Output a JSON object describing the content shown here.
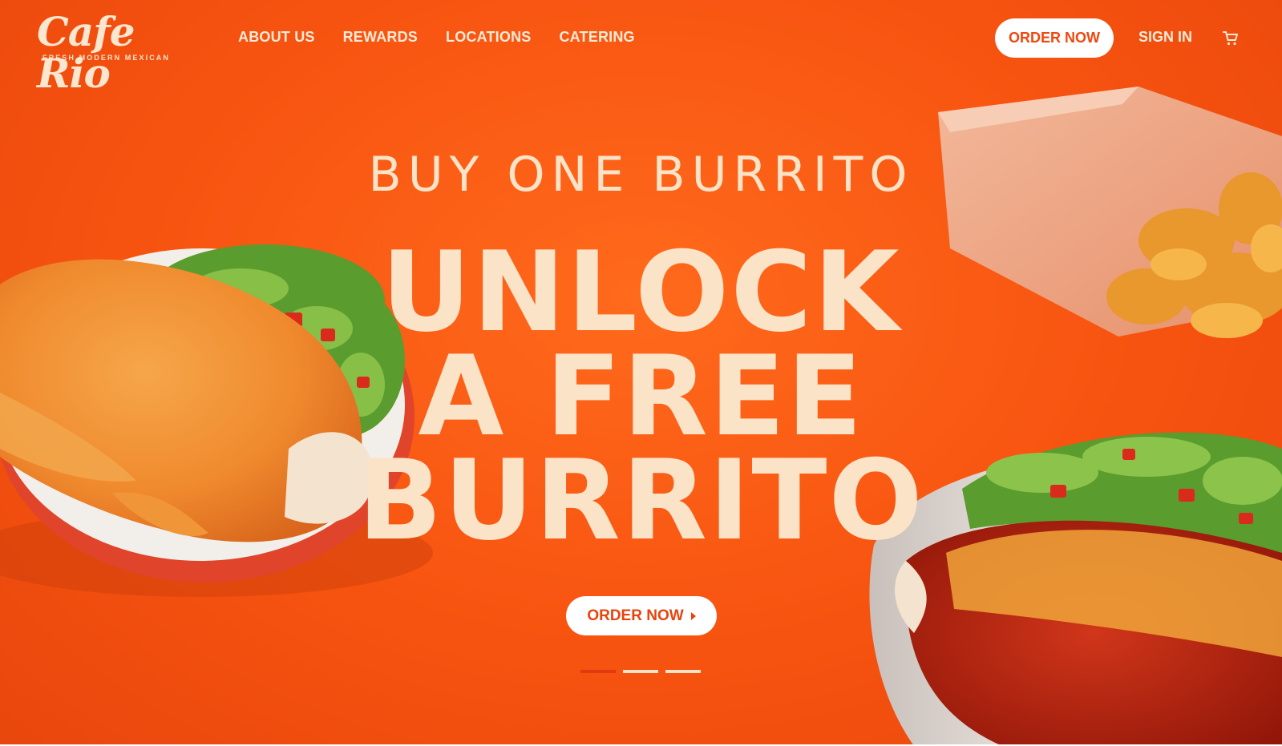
{
  "brand": {
    "name": "Cafe Rio",
    "tagline": "FRESH MODERN MEXICAN"
  },
  "nav": {
    "items": [
      "ABOUT US",
      "REWARDS",
      "LOCATIONS",
      "CATERING"
    ],
    "order_now": "ORDER NOW",
    "sign_in": "SIGN IN",
    "cart_icon": "cart-icon"
  },
  "hero": {
    "eyebrow": "BUY ONE BURRITO",
    "headline": [
      "UNLOCK",
      "A FREE",
      "BURRITO"
    ],
    "cta": "ORDER NOW",
    "slides": {
      "count": 3,
      "active_index": 0
    }
  },
  "colors": {
    "background": "#f75310",
    "cream": "#fbe3c8",
    "button_text": "#e8430e",
    "active_dot": "#e23a0e"
  }
}
